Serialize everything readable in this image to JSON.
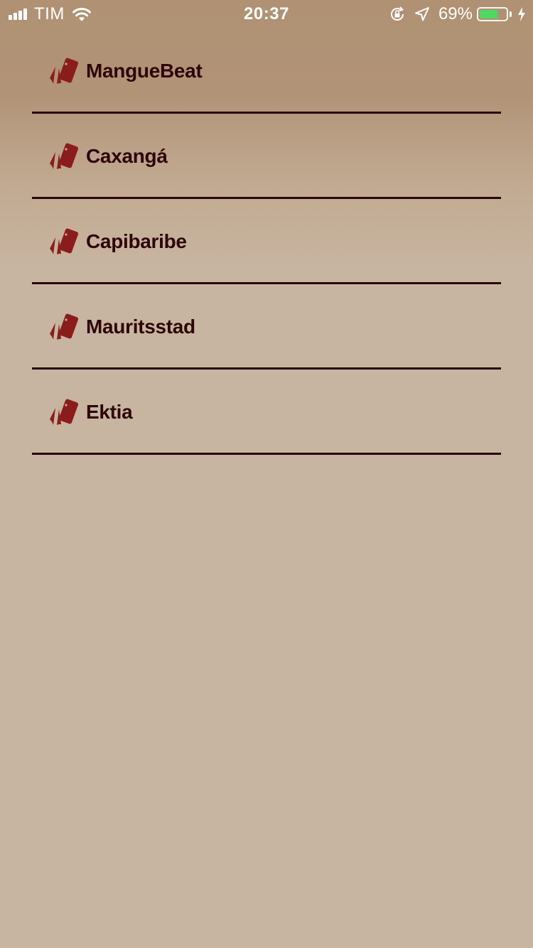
{
  "status_bar": {
    "carrier": "TIM",
    "time": "20:37",
    "battery_percent": "69%",
    "battery_level": 0.69,
    "battery_color": "#4cd964",
    "icons": [
      "signal-icon",
      "wifi-icon",
      "rotation-lock-icon",
      "location-icon",
      "battery-icon",
      "charging-bolt-icon"
    ]
  },
  "menu": {
    "item_icon": "tag-icon",
    "accent_color": "#8b1c1c",
    "text_color": "#2e0606",
    "items": [
      {
        "label": "MangueBeat"
      },
      {
        "label": "Caxangá"
      },
      {
        "label": "Capibaribe"
      },
      {
        "label": "Mauritsstad"
      },
      {
        "label": "Ektia"
      }
    ]
  }
}
